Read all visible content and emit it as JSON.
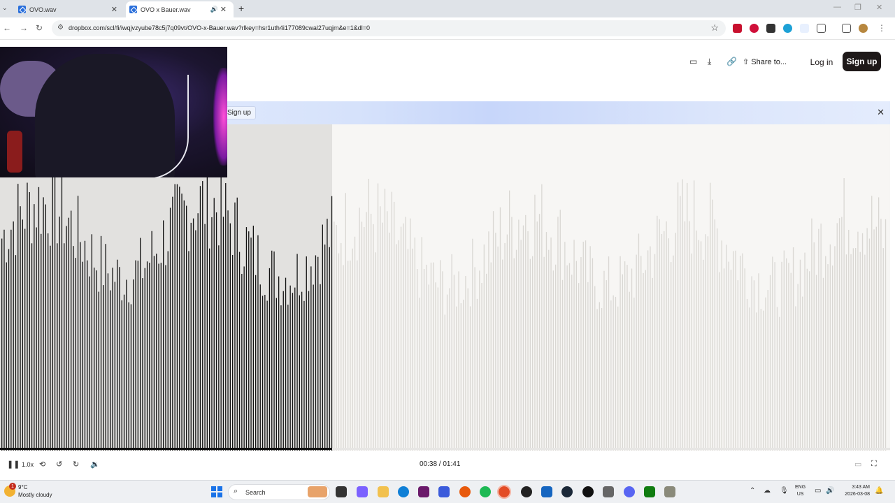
{
  "browser": {
    "tabs": [
      {
        "title": "OVO.wav",
        "active": false
      },
      {
        "title": "OVO x Bauer.wav",
        "active": true
      }
    ],
    "url": "dropbox.com/scl/fi/iwqjvzyube78c5j7q09vt/OVO-x-Bauer.wav?rlkey=hsr1uth4i177089cwal27uqjm&e=1&dl=0"
  },
  "header": {
    "share_label": "Share to...",
    "login_label": "Log in",
    "signup_label": "Sign up"
  },
  "banner": {
    "signup_label": "Sign up"
  },
  "player": {
    "speed": "1.0x",
    "time": "00:38 / 01:41",
    "progress_fraction": 0.373
  },
  "taskbar": {
    "weather_temp": "9°C",
    "weather_desc": "Mostly cloudy",
    "weather_badge": "1",
    "search_placeholder": "Search",
    "lang_top": "ENG",
    "lang_bottom": "US",
    "clock_time": "3:43 AM",
    "clock_date": "2026-03-08"
  },
  "colors": {
    "played_wave": "#111111",
    "unplayed_wave": "#d9d7d3",
    "brand_dark": "#1e1919"
  }
}
